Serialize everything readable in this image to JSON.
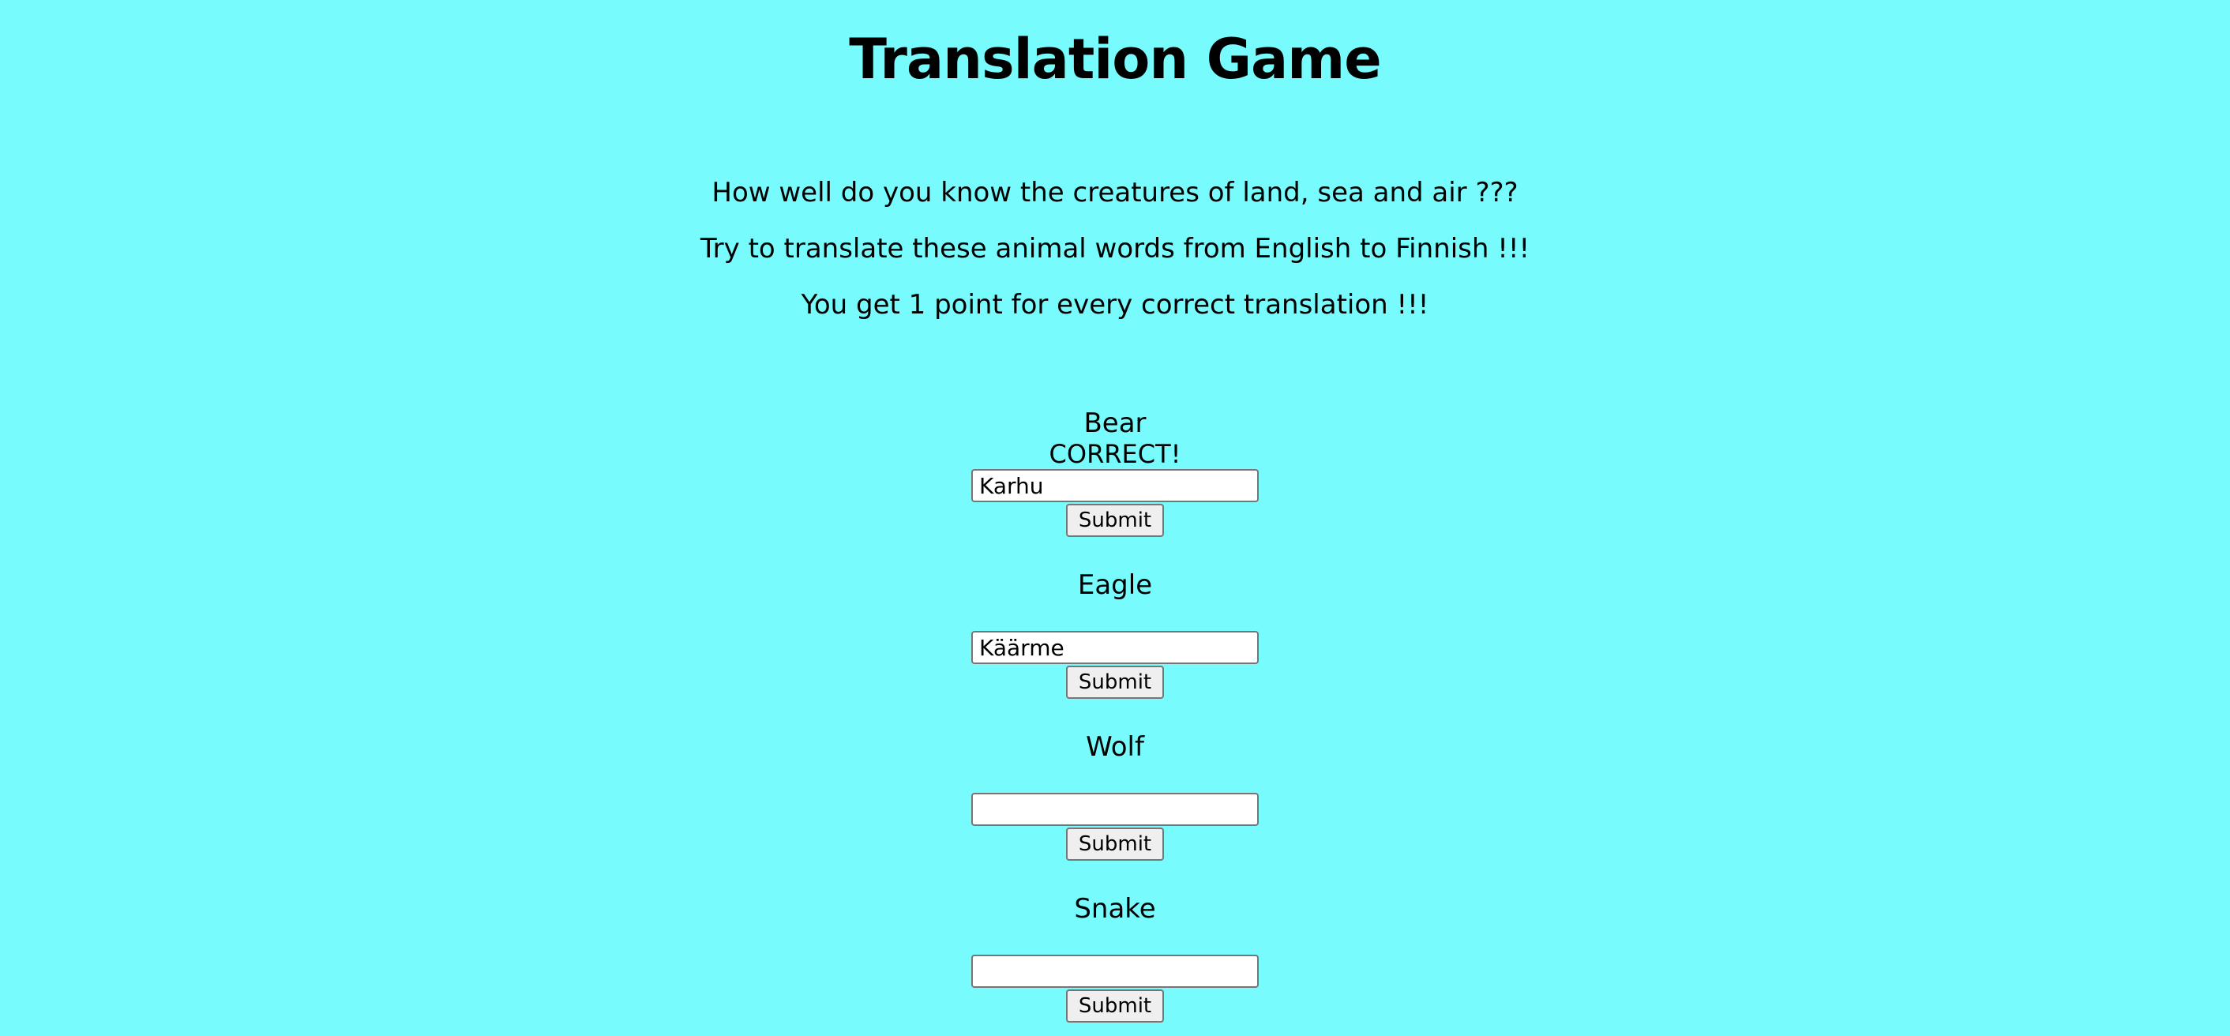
{
  "title": "Translation Game",
  "intro": [
    "How well do you know the creatures of land, sea and air ???",
    "Try to translate these animal words from English to Finnish !!!",
    "You get 1 point for every correct translation !!!"
  ],
  "questions": [
    {
      "word": "Bear",
      "result": "CORRECT!",
      "answer": "Karhu",
      "submit_label": "Submit"
    },
    {
      "word": "Eagle",
      "result": "",
      "answer": "Käärme",
      "submit_label": "Submit"
    },
    {
      "word": "Wolf",
      "result": "",
      "answer": "",
      "submit_label": "Submit"
    },
    {
      "word": "Snake",
      "result": "",
      "answer": "",
      "submit_label": "Submit"
    }
  ],
  "colors": {
    "background": "#78fbfd"
  }
}
